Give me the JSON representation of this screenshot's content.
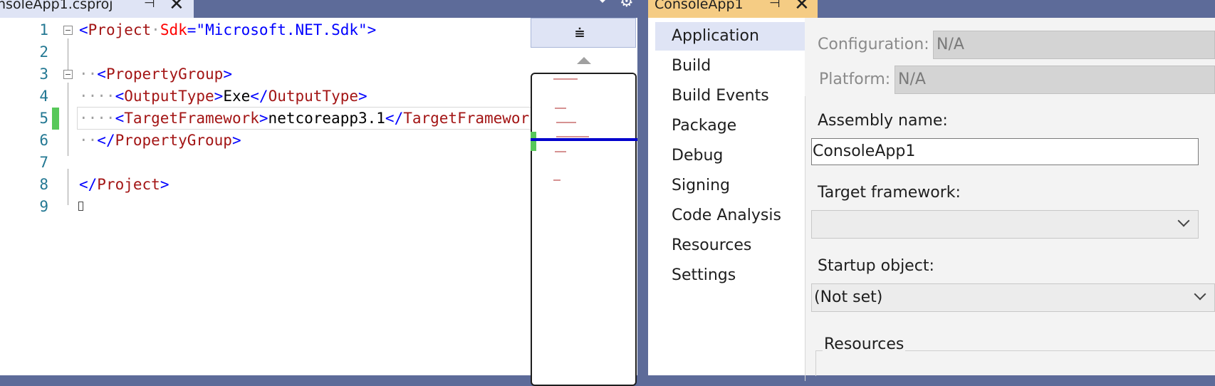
{
  "editor": {
    "tab_title": "nsoleApp1.csproj",
    "pin_glyph": "⊣",
    "close_glyph": "✕",
    "gear_glyph": "⚙",
    "lines": [
      {
        "n": "1"
      },
      {
        "n": "2"
      },
      {
        "n": "3"
      },
      {
        "n": "4"
      },
      {
        "n": "5"
      },
      {
        "n": "6"
      },
      {
        "n": "7"
      },
      {
        "n": "8"
      },
      {
        "n": "9"
      }
    ],
    "code": {
      "l1_open": "<",
      "l1_tag": "Project",
      "l1_dot": "·",
      "l1_attr": "Sdk",
      "l1_eq": "=\"",
      "l1_val": "Microsoft.NET.Sdk",
      "l1_close": "\">",
      "l3_ws": "··",
      "l3_open": "<",
      "l3_tag": "PropertyGroup",
      "l3_close": ">",
      "l4_ws": "····",
      "l4_open": "<",
      "l4_tag": "OutputType",
      "l4_gt": ">",
      "l4_text": "Exe",
      "l4_endopen": "</",
      "l4_endtag": "OutputType",
      "l4_endgt": ">",
      "l5_ws": "····",
      "l5_open": "<",
      "l5_tag": "TargetFramework",
      "l5_gt": ">",
      "l5_text": "netcoreapp3.1",
      "l5_endopen": "</",
      "l5_endtag": "TargetFramework",
      "l6_ws": "··",
      "l6_open": "</",
      "l6_tag": "PropertyGroup",
      "l6_close": ">",
      "l8_open": "</",
      "l8_tag": "Project",
      "l8_close": ">"
    },
    "map_button_glyph": "⩧"
  },
  "properties": {
    "tab_title": "ConsoleApp1",
    "pin_glyph": "⊣",
    "close_glyph": "✕",
    "nav": [
      {
        "label": "Application",
        "selected": true
      },
      {
        "label": "Build"
      },
      {
        "label": "Build Events"
      },
      {
        "label": "Package"
      },
      {
        "label": "Debug"
      },
      {
        "label": "Signing"
      },
      {
        "label": "Code Analysis"
      },
      {
        "label": "Resources"
      },
      {
        "label": "Settings"
      }
    ],
    "configuration_label": "Configuration:",
    "configuration_value": "N/A",
    "platform_label": "Platform:",
    "platform_value": "N/A",
    "assembly_name_label": "Assembly name:",
    "assembly_name_value": "ConsoleApp1",
    "target_framework_label": "Target framework:",
    "target_framework_value": "",
    "startup_object_label": "Startup object:",
    "startup_object_value": "(Not set)",
    "resources_label": "Resources"
  },
  "colors": {
    "accent_tab": "#f5cc84",
    "frame": "#5d6b99",
    "change_bar": "#57c85a"
  }
}
